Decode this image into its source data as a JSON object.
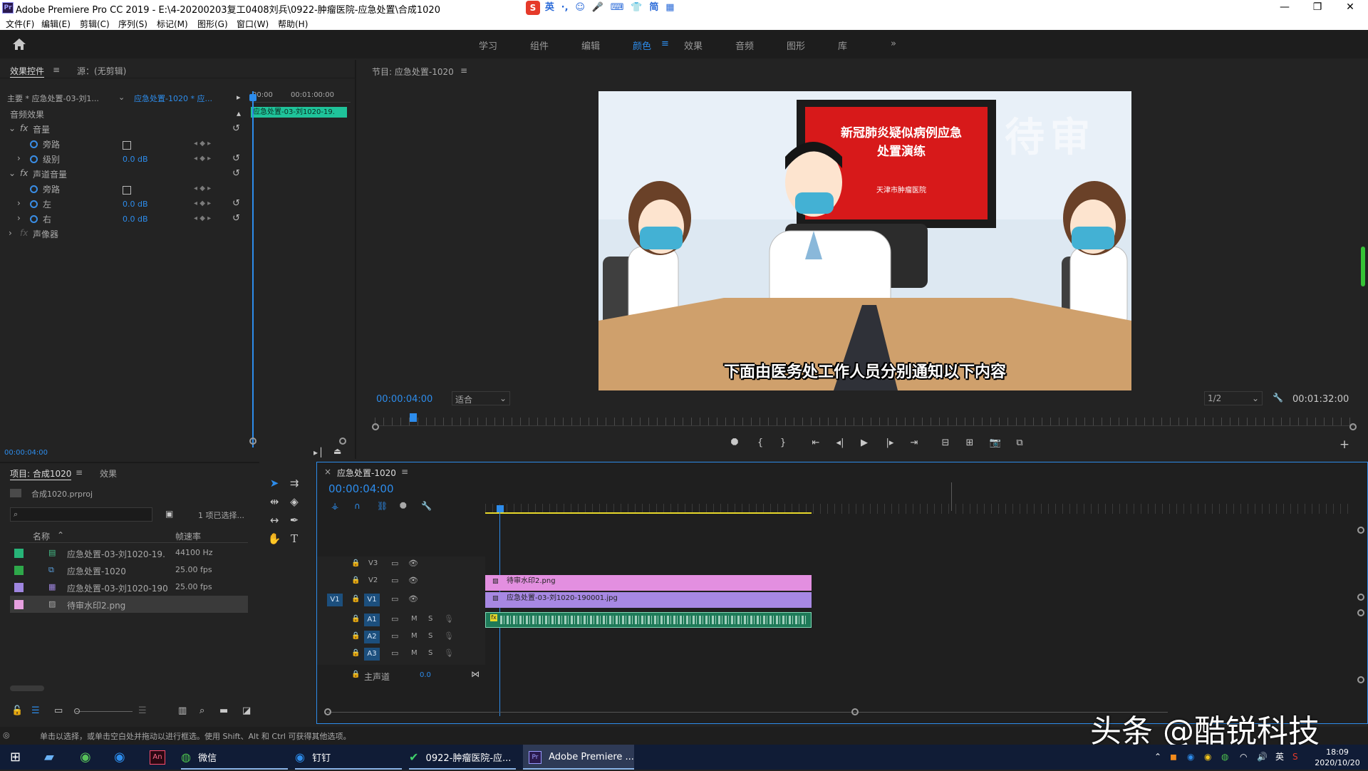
{
  "titlebar": {
    "logo": "Pr",
    "title": "Adobe Premiere Pro CC 2019 - E:\\4-20200203复工0408刘兵\\0922-肿瘤医院-应急处置\\合成1020",
    "ime": [
      "英",
      "·,",
      "☺",
      "🎤",
      "⌨",
      "👕",
      "简",
      "▦"
    ],
    "ime_logo": "S",
    "controls": [
      "—",
      "❐",
      "✕"
    ]
  },
  "menu": [
    "文件(F)",
    "编辑(E)",
    "剪辑(C)",
    "序列(S)",
    "标记(M)",
    "图形(G)",
    "窗口(W)",
    "帮助(H)"
  ],
  "workspaces": [
    {
      "label": "学习",
      "active": false
    },
    {
      "label": "组件",
      "active": false
    },
    {
      "label": "编辑",
      "active": false
    },
    {
      "label": "颜色",
      "active": true
    },
    {
      "label": "效果",
      "active": false
    },
    {
      "label": "音频",
      "active": false
    },
    {
      "label": "图形",
      "active": false
    },
    {
      "label": "库",
      "active": false
    }
  ],
  "workspace_more": "»",
  "effect_controls": {
    "tab_active": "效果控件",
    "tab_source": "源：(无剪辑)",
    "master_label": "主要 * 应急处置-03-刘1...",
    "sequence_label": "应急处置-1020 * 应...",
    "ruler_start": "00:00",
    "ruler_mid": "00:01:00:00",
    "clip_bar": "应急处置-03-刘1020-19.",
    "section_audio": "音频效果",
    "volume": "音量",
    "bypass": "旁路",
    "level": "级别",
    "level_value": "0.0 dB",
    "channel_volume": "声道音量",
    "bypass2": "旁路",
    "left": "左",
    "left_value": "0.0 dB",
    "right": "右",
    "right_value": "0.0 dB",
    "panner": "声像器",
    "fx": "fx",
    "timecode": "00:00:04:00"
  },
  "program": {
    "title": "节目: 应急处置-1020",
    "timecode": "00:00:04:00",
    "fit": "适合",
    "resolution": "1/2",
    "duration": "00:01:32:00",
    "scene": {
      "sign_line1": "新冠肺炎疑似病例应急",
      "sign_line2": "处置演练",
      "sign_sub": "天津市肿瘤医院",
      "watermark": "待审",
      "subtitle": "下面由医务处工作人员分别通知以下内容"
    },
    "transport": [
      "⯃",
      "{",
      "}",
      "⇤",
      "◂|",
      "▶",
      "|▸",
      "⇥",
      "⊟",
      "⊞",
      "📷",
      "⧉"
    ],
    "add": "+"
  },
  "project": {
    "tab_active": "项目: 合成1020",
    "tab_effects": "效果",
    "file": "合成1020.prproj",
    "search_placeholder": "",
    "selection": "1 项已选择...",
    "col_name": "名称",
    "col_rate": "帧速率",
    "items": [
      {
        "name": "应急处置-03-刘1020-19.",
        "rate": "44100 Hz",
        "color": "#27b478"
      },
      {
        "name": "应急处置-1020",
        "rate": "25.00 fps",
        "color": "#2ea84a"
      },
      {
        "name": "应急处置-03-刘1020-190",
        "rate": "25.00 fps",
        "color": "#9f86e0"
      },
      {
        "name": "待审水印2.png",
        "rate": "",
        "color": "#e7a0e0"
      }
    ]
  },
  "timeline": {
    "close": "×",
    "title": "应急处置-1020",
    "timecode": "00:00:04:00",
    "tracks": {
      "v3": "V3",
      "v2": "V2",
      "v1": "V1",
      "v1_src": "V1",
      "a1": "A1",
      "a2": "A2",
      "a3": "A3",
      "m": "M",
      "s": "S",
      "master": "主声道",
      "master_value": "0.0"
    },
    "clips": {
      "v2": "待审水印2.png",
      "v1": "应急处置-03-刘1020-190001.jpg",
      "a1_fx": "fx"
    }
  },
  "status": "单击以选择，或单击空白处并拖动以进行框选。使用 Shift、Alt 和 Ctrl 可获得其他选项。",
  "watermark_overlay": "头条 @酷锐科技",
  "taskbar": {
    "apps": [
      {
        "label": "微信"
      },
      {
        "label": "钉钉"
      },
      {
        "label": "0922-肿瘤医院-应..."
      },
      {
        "label": "Adobe Premiere ..."
      }
    ],
    "premiere_badge": "Pr",
    "an_badge": "An",
    "tray_lang": "英",
    "time": "18:09",
    "date": "2020/10/20"
  }
}
